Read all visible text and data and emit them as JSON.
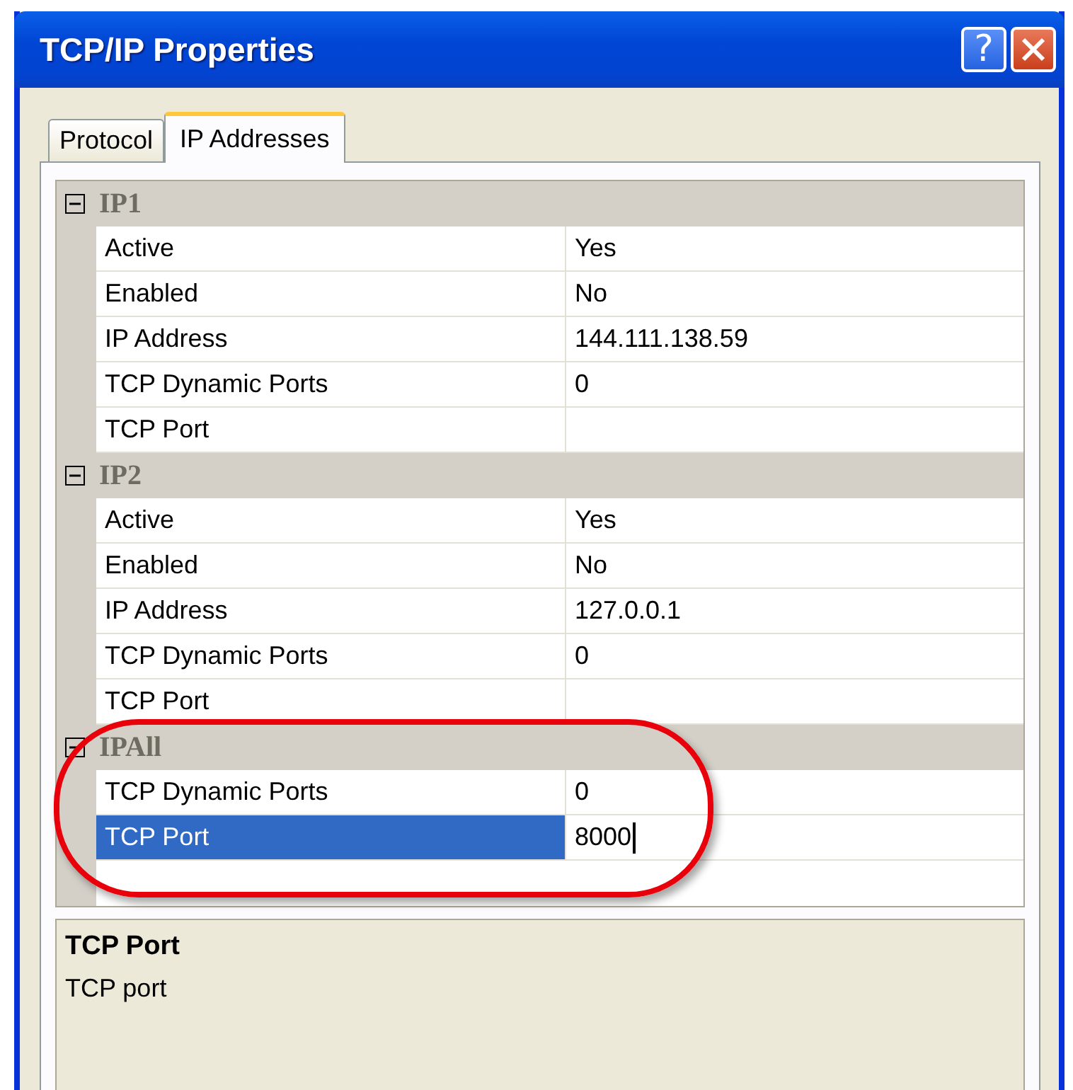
{
  "window": {
    "title": "TCP/IP Properties",
    "help_button": "?"
  },
  "tabs": [
    {
      "label": "Protocol",
      "selected": false
    },
    {
      "label": "IP Addresses",
      "selected": true
    }
  ],
  "groups": [
    {
      "name": "IP1",
      "expanded": true,
      "rows": [
        {
          "label": "Active",
          "value": "Yes",
          "selected": false
        },
        {
          "label": "Enabled",
          "value": "No",
          "selected": false
        },
        {
          "label": "IP Address",
          "value": "144.111.138.59",
          "selected": false
        },
        {
          "label": "TCP Dynamic Ports",
          "value": "0",
          "selected": false
        },
        {
          "label": "TCP Port",
          "selected": false
        }
      ]
    },
    {
      "name": "IP2",
      "expanded": true,
      "rows": [
        {
          "label": "Active",
          "value": "Yes",
          "selected": false
        },
        {
          "label": "Enabled",
          "value": "No",
          "selected": false
        },
        {
          "label": "IP Address",
          "value": "127.0.0.1",
          "selected": false
        },
        {
          "label": "TCP Dynamic Ports",
          "value": "0",
          "selected": false
        },
        {
          "label": "TCP Port",
          "selected": false
        }
      ]
    },
    {
      "name": "IPAll",
      "expanded": true,
      "rows": [
        {
          "label": "TCP Dynamic Ports",
          "value": "0",
          "selected": false
        },
        {
          "label": "TCP Port",
          "value": "8000",
          "selected": true
        }
      ]
    }
  ],
  "description": {
    "title": "TCP Port",
    "text": "TCP port"
  }
}
